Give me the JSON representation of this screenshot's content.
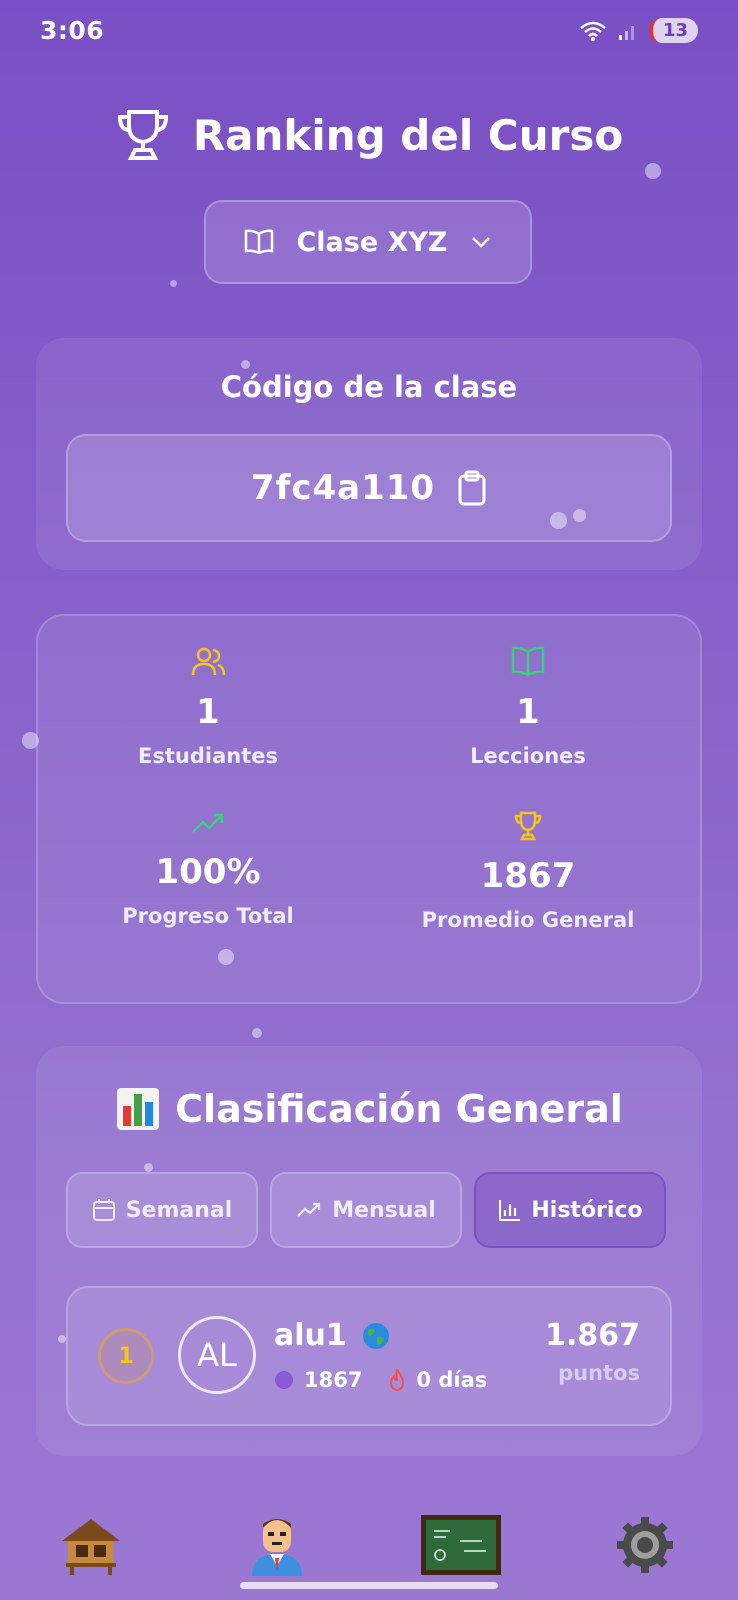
{
  "status_bar": {
    "time": "3:06",
    "notification_count": "13"
  },
  "header": {
    "title": "Ranking del Curso",
    "trophy_icon": "trophy-icon"
  },
  "class_selector": {
    "selected": "Clase XYZ"
  },
  "class_code": {
    "heading": "Código de la clase",
    "value": "7fc4a110"
  },
  "stats": {
    "students": {
      "value": "1",
      "label": "Estudiantes"
    },
    "lessons": {
      "value": "1",
      "label": "Lecciones"
    },
    "progress": {
      "value": "100%",
      "label": "Progreso Total"
    },
    "average": {
      "value": "1867",
      "label": "Promedio General"
    }
  },
  "ranking": {
    "heading": "Clasificación General",
    "tabs": [
      "Semanal",
      "Mensual",
      "Histórico"
    ],
    "active_tab": "Histórico",
    "entries": [
      {
        "position": "1",
        "initials": "AL",
        "name": "alu1",
        "xp": "1867",
        "streak": "0 días",
        "points": "1.867",
        "points_unit": "puntos"
      }
    ]
  },
  "colors": {
    "accent_yellow": "#f5c518",
    "accent_green": "#3ecf7a",
    "background": "#8560c9"
  },
  "bottom_nav": [
    "home-icon",
    "profile-icon",
    "classroom-icon",
    "settings-icon"
  ]
}
